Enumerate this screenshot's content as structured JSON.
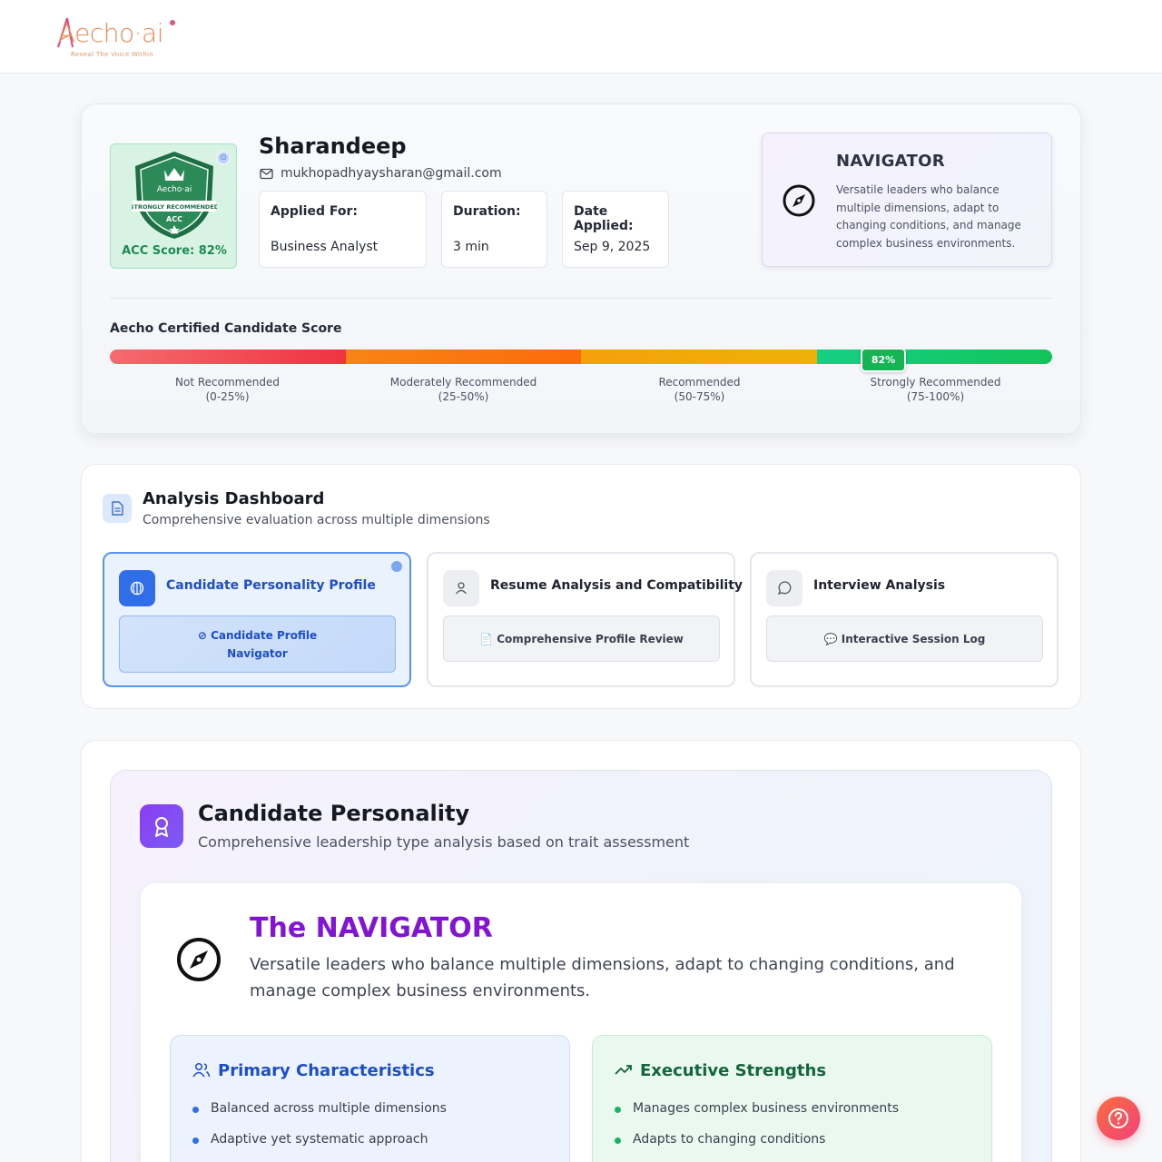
{
  "header": {
    "logo_text": "Aecho·ai",
    "logo_tagline": "Reveal The Voice Within"
  },
  "candidate": {
    "name": "Sharandeep",
    "email": "mukhopadhyaysharan@gmail.com",
    "badge": {
      "brand": "Aecho·ai",
      "ribbon": "STRONGLY RECOMMENDED",
      "acc_label": "ACC",
      "score_text": "ACC Score: 82%"
    },
    "applied_for_label": "Applied For:",
    "applied_for": "Business Analyst",
    "duration_label": "Duration:",
    "duration": "3 min",
    "date_label": "Date Applied:",
    "date": "Sep 9, 2025"
  },
  "navigator_card": {
    "title": "NAVIGATOR",
    "description": "Versatile leaders who balance multiple dimensions, adapt to changing conditions, and manage complex business environments."
  },
  "score_scale": {
    "title": "Aecho Certified Candidate Score",
    "value_text": "82%",
    "value": 82,
    "segments": [
      {
        "label": "Not Recommended",
        "range": "(0-25%)",
        "color": "#ef3340"
      },
      {
        "label": "Moderately Recommended",
        "range": "(25-50%)",
        "color": "#fb6b0a"
      },
      {
        "label": "Recommended",
        "range": "(50-75%)",
        "color": "#edb208"
      },
      {
        "label": "Strongly Recommended",
        "range": "(75-100%)",
        "color": "#12c45a"
      }
    ]
  },
  "dashboard": {
    "title": "Analysis Dashboard",
    "subtitle": "Comprehensive evaluation across multiple dimensions",
    "tabs": [
      {
        "title": "Candidate Personality Profile",
        "button_line1": "⊘ Candidate Profile",
        "button_line2": "Navigator",
        "icon": "brain-icon",
        "active": true
      },
      {
        "title": "Resume Analysis and Compatibility",
        "button": "📄 Comprehensive Profile Review",
        "icon": "user-icon",
        "active": false
      },
      {
        "title": "Interview Analysis",
        "button": "💬 Interactive Session Log",
        "icon": "chat-icon",
        "active": false
      }
    ]
  },
  "personality": {
    "title": "Candidate Personality",
    "subtitle": "Comprehensive leadership type analysis based on trait assessment",
    "type_title": "The NAVIGATOR",
    "type_description": "Versatile leaders who balance multiple dimensions, adapt to changing conditions, and manage complex business environments.",
    "primary": {
      "title": "Primary Characteristics",
      "items": [
        "Balanced across multiple dimensions",
        "Adaptive yet systematic approach"
      ]
    },
    "strengths": {
      "title": "Executive Strengths",
      "items": [
        "Manages complex business environments",
        "Adapts to changing conditions"
      ]
    }
  },
  "colors": {
    "accent_blue": "#2f6ee8",
    "purple": "#8414d3",
    "green": "#12c45a"
  }
}
